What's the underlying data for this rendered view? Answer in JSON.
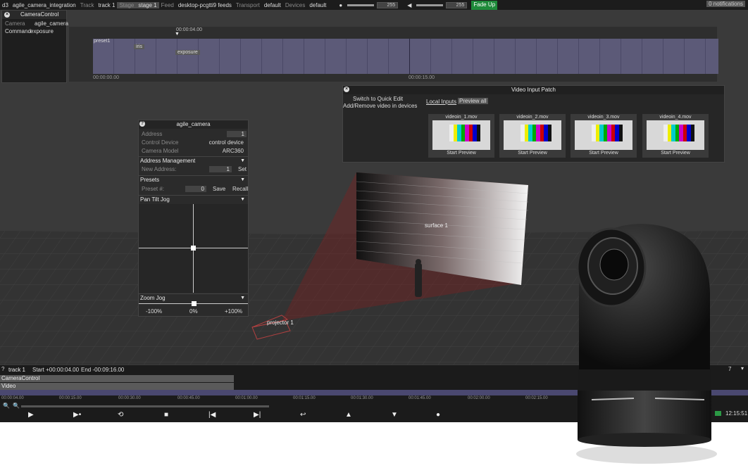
{
  "topbar": {
    "app": "d3",
    "project": "agile_camera_integration",
    "track_label": "Track",
    "track_value": "track 1",
    "stage_label": "Stage",
    "stage_value": "stage 1",
    "feed_label": "Feed",
    "feed_value": "desktop-pcgtti9 feeds",
    "transport_label": "Transport",
    "transport_value": "default",
    "devices_label": "Devices",
    "devices_value": "default",
    "brightness_value": "255",
    "volume_value": "255",
    "fade_button": "Fade Up",
    "notifications": "0 notifications"
  },
  "camera_control": {
    "title": "CameraControl",
    "camera_label": "Camera",
    "camera_value": "agile_camera",
    "command_label": "Command",
    "command_value": "exposure"
  },
  "timeline": {
    "playhead_time": "00:00:04.00",
    "start_time": "00:00:00.00",
    "mid_time": "00:00:15.00",
    "tags": [
      "preset1",
      "iris",
      "exposure"
    ]
  },
  "video_input_patch": {
    "title": "Video Input Patch",
    "switch_text": "Switch to Quick Edit",
    "addremove_text": "Add/Remove video in devices",
    "tab_local": "Local Inputs",
    "tab_preview_all": "Preview all",
    "inputs": [
      {
        "name": "videoin_1.mov",
        "action": "Start Preview"
      },
      {
        "name": "videoin_2.mov",
        "action": "Start Preview"
      },
      {
        "name": "videoin_3.mov",
        "action": "Start Preview"
      },
      {
        "name": "videoin_4.mov",
        "action": "Start Preview"
      }
    ]
  },
  "agile_camera": {
    "title": "agile_camera",
    "address_label": "Address",
    "address_value": "1",
    "control_device_label": "Control Device",
    "control_device_value": "control device",
    "camera_model_label": "Camera Model",
    "camera_model_value": "ARC360",
    "address_mgmt": "Address Management",
    "new_address_label": "New Address:",
    "new_address_value": "1",
    "set_button": "Set",
    "presets": "Presets",
    "preset_label": "Preset #:",
    "preset_value": "0",
    "save_button": "Save",
    "recall_button": "Recall",
    "pan_tilt": "Pan Tilt Jog",
    "zoom_jog": "Zoom Jog",
    "zoom_min": "-100%",
    "zoom_mid": "0%",
    "zoom_max": "+100%",
    "zoom_level": 0.5
  },
  "scene": {
    "surface_label": "surface 1",
    "projector_label": "projector 1"
  },
  "bottom": {
    "track": "track 1",
    "start": "Start +00:00:04.00",
    "end": "End -00:09:16.00",
    "tracks": [
      "CameraControl",
      "Video"
    ],
    "ticks": [
      "00:00:04.00",
      "00:00:15.00",
      "00:00:30.00",
      "00:00:45.00",
      "00:01:00.00",
      "00:01:15.00",
      "00:01:30.00",
      "00:01:45.00",
      "00:02:00.00",
      "00:02:15.00"
    ],
    "clock": "12:15:51",
    "right_count": "7"
  },
  "colors": {
    "accent_green": "#1e8a3a",
    "timeline_purple": "#5c5a78",
    "projector_red": "#8a1c1c"
  }
}
